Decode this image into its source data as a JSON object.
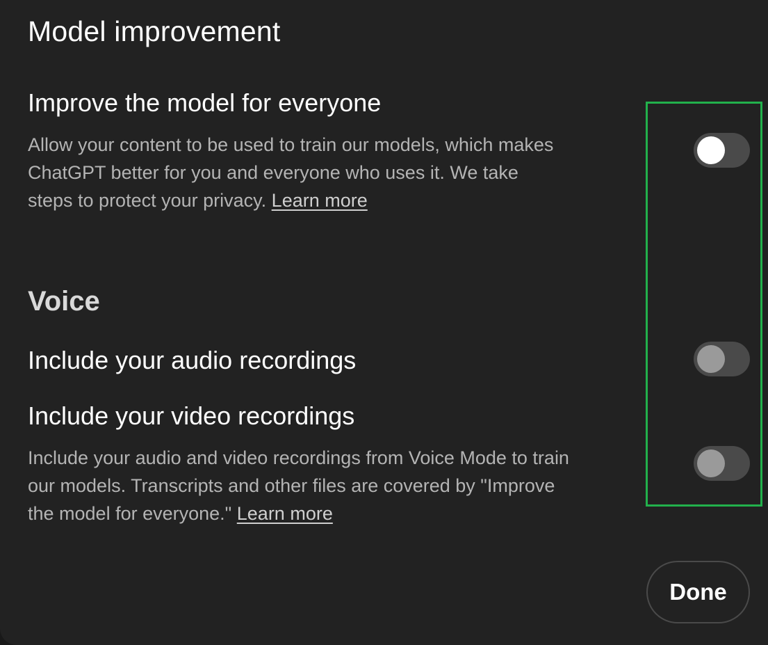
{
  "dialog": {
    "title": "Model improvement"
  },
  "improve": {
    "title": "Improve the model for everyone",
    "description": "Allow your content to be used to train our models, which makes ChatGPT better for you and everyone who uses it. We take steps to protect your privacy.",
    "link_label": "Learn more",
    "toggle_state": "on"
  },
  "voice": {
    "section_title": "Voice",
    "audio": {
      "title": "Include your audio recordings",
      "toggle_state": "off"
    },
    "video": {
      "title": "Include your video recordings",
      "description": "Include your audio and video recordings from Voice Mode to train our models. Transcripts and other files are covered by \"Improve the model for everyone.\"",
      "link_label": "Learn more",
      "toggle_state": "off"
    }
  },
  "footer": {
    "done_label": "Done"
  },
  "colors": {
    "background": "#222222",
    "highlight": "#22b14c",
    "toggle_track": "#4a4a4a"
  }
}
